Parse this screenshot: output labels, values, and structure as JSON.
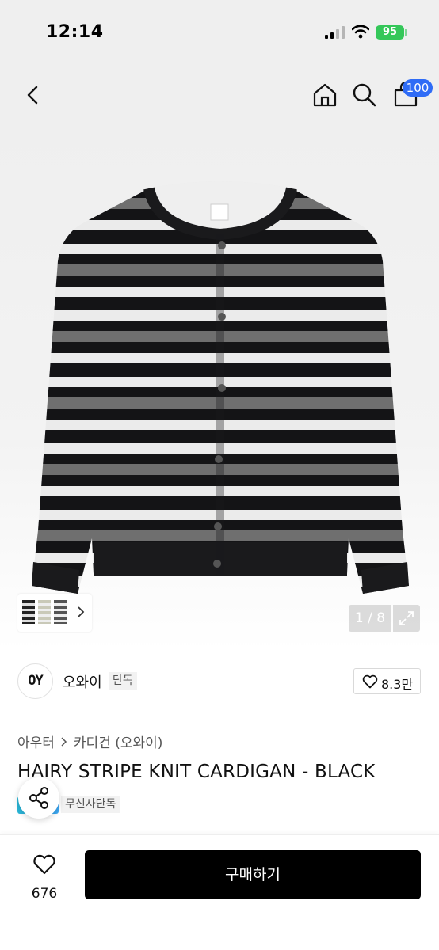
{
  "status_bar": {
    "time": "12:14",
    "battery": "95"
  },
  "header": {
    "back_icon": "chevron-left-icon",
    "home_icon": "home-icon",
    "search_icon": "search-icon",
    "cart_icon": "shopping-bag-icon",
    "cart_count": "100",
    "badge_color": "#2f6cf6"
  },
  "gallery": {
    "counter": "1 / 8",
    "expand_icon": "expand-icon",
    "thumb_chevron_icon": "chevron-right-icon"
  },
  "brand": {
    "logo_text": "OY",
    "name": "오와이",
    "exclusive_label": "단독",
    "like_count": "8.3만"
  },
  "breadcrumb": {
    "items": [
      "아우터",
      "카디건 (오와이)"
    ]
  },
  "product": {
    "title": "HAIRY STRIPE KNIT CARDIGAN - BLACK",
    "tag": "무신사단독"
  },
  "share_icon": "share-icon",
  "bottom": {
    "like_count": "676",
    "buy_label": "구매하기"
  },
  "colors": {
    "buy_button": "#000000",
    "battery": "#34c759"
  }
}
